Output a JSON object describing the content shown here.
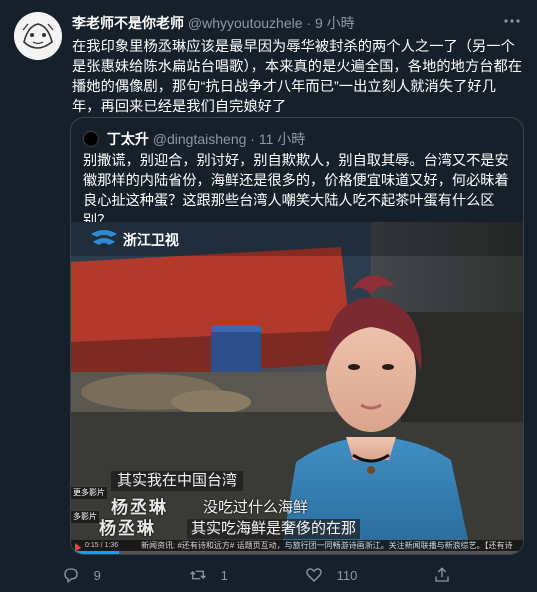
{
  "tweet": {
    "author_name": "李老师不是你老师",
    "author_handle": "@whyyoutouzhele",
    "separator": "·",
    "time": "9 小時",
    "text": "在我印象里杨丞琳应该是最早因为辱华被封杀的两个人之一了（另一个是张惠妹给陈水扁站台唱歌），本来真的是火遍全国，各地的地方台都在播她的偶像剧，那句“抗日战争才八年而已”一出立刻人就消失了好几年，再回来已经是我们自完娘好了"
  },
  "quoted_tweet": {
    "author_name": "丁太升",
    "author_handle": "@dingtaisheng",
    "separator": "·",
    "time": "11 小時",
    "text": "别撒谎，别迎合，别讨好，别自欺欺人，别自取其辱。台湾又不是安徽那样的内陆省份，海鲜还是很多的，价格便宜味道又好，何必昧着良心扯这种蛋？这跟那些台湾人嘲笑大陆人吃不起茶叶蛋有什么区别？"
  },
  "video": {
    "channel_logo_text": "浙江卫视",
    "subtitle_top": "其实我在中国台湾",
    "speaker_name_1": "杨丞琳",
    "subtitle_mid": "没吃过什么海鲜",
    "speaker_name_2": "杨丞琳",
    "subtitle_bottom": "其实吃海鲜是奢侈的在那",
    "side_label_1": "更多影片",
    "side_label_2": "多影片",
    "ticker_text": "新闻资讯: #还有诗和远方# 话题页互动，与旅行团一同畅游诗画浙江。关注新闻联播与新浪综艺。【还有诗",
    "time_display": "0:15 / 1:36"
  },
  "actions": {
    "replies": "9",
    "retweets": "1",
    "likes": "110"
  },
  "colors": {
    "background": "#15202b",
    "secondary_text": "#8b98a5",
    "border": "#38444d"
  }
}
